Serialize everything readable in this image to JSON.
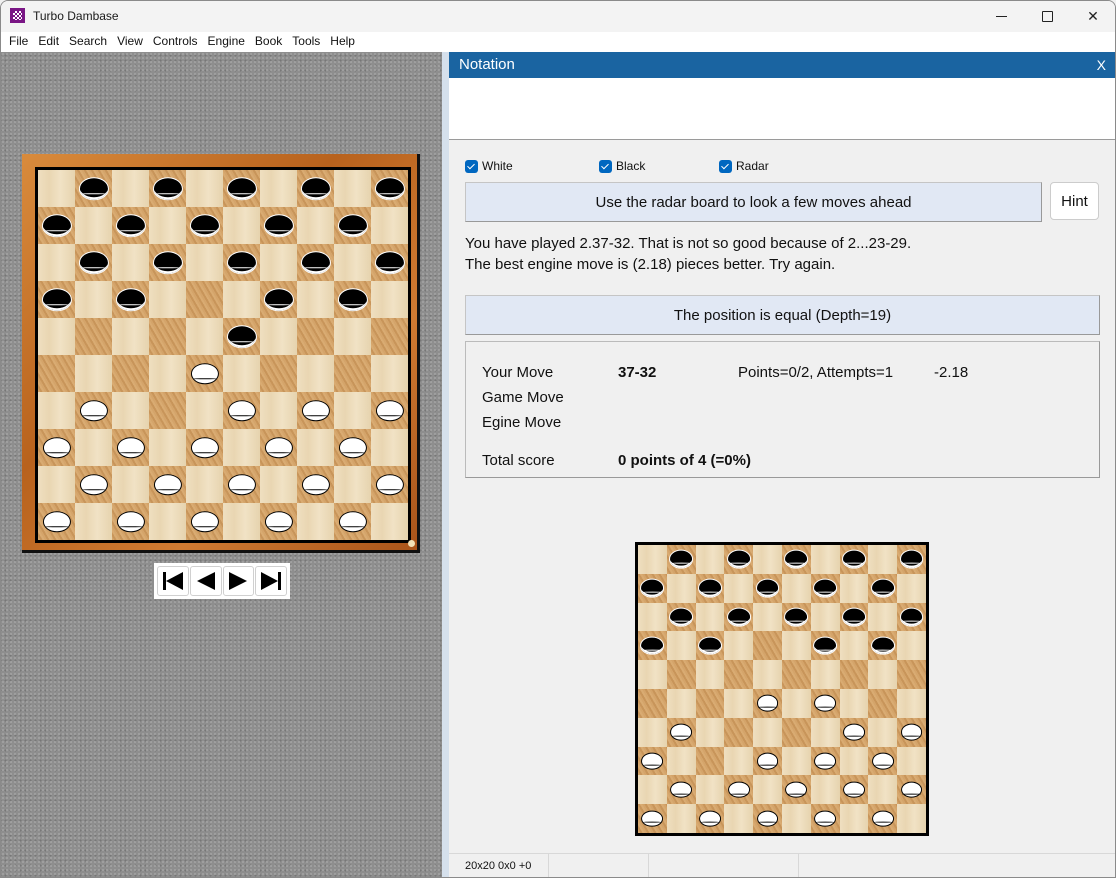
{
  "window": {
    "title": "Turbo Dambase",
    "controls": [
      "minimize",
      "maximize",
      "close"
    ]
  },
  "menu": [
    "File",
    "Edit",
    "Search",
    "View",
    "Controls",
    "Engine",
    "Book",
    "Tools",
    "Help"
  ],
  "main_board": {
    "size": 10,
    "pieces": [
      {
        "row": 0,
        "col": 1,
        "color": "black"
      },
      {
        "row": 0,
        "col": 3,
        "color": "black"
      },
      {
        "row": 0,
        "col": 5,
        "color": "black"
      },
      {
        "row": 0,
        "col": 7,
        "color": "black"
      },
      {
        "row": 0,
        "col": 9,
        "color": "black"
      },
      {
        "row": 1,
        "col": 0,
        "color": "black"
      },
      {
        "row": 1,
        "col": 2,
        "color": "black"
      },
      {
        "row": 1,
        "col": 4,
        "color": "black"
      },
      {
        "row": 1,
        "col": 6,
        "color": "black"
      },
      {
        "row": 1,
        "col": 8,
        "color": "black"
      },
      {
        "row": 2,
        "col": 1,
        "color": "black"
      },
      {
        "row": 2,
        "col": 3,
        "color": "black"
      },
      {
        "row": 2,
        "col": 5,
        "color": "black"
      },
      {
        "row": 2,
        "col": 7,
        "color": "black"
      },
      {
        "row": 2,
        "col": 9,
        "color": "black"
      },
      {
        "row": 3,
        "col": 0,
        "color": "black"
      },
      {
        "row": 3,
        "col": 2,
        "color": "black"
      },
      {
        "row": 3,
        "col": 6,
        "color": "black"
      },
      {
        "row": 3,
        "col": 8,
        "color": "black"
      },
      {
        "row": 4,
        "col": 5,
        "color": "black"
      },
      {
        "row": 5,
        "col": 4,
        "color": "white"
      },
      {
        "row": 6,
        "col": 1,
        "color": "white"
      },
      {
        "row": 6,
        "col": 5,
        "color": "white"
      },
      {
        "row": 6,
        "col": 7,
        "color": "white"
      },
      {
        "row": 6,
        "col": 9,
        "color": "white"
      },
      {
        "row": 7,
        "col": 0,
        "color": "white"
      },
      {
        "row": 7,
        "col": 2,
        "color": "white"
      },
      {
        "row": 7,
        "col": 4,
        "color": "white"
      },
      {
        "row": 7,
        "col": 6,
        "color": "white"
      },
      {
        "row": 7,
        "col": 8,
        "color": "white"
      },
      {
        "row": 8,
        "col": 1,
        "color": "white"
      },
      {
        "row": 8,
        "col": 3,
        "color": "white"
      },
      {
        "row": 8,
        "col": 5,
        "color": "white"
      },
      {
        "row": 8,
        "col": 7,
        "color": "white"
      },
      {
        "row": 8,
        "col": 9,
        "color": "white"
      },
      {
        "row": 9,
        "col": 0,
        "color": "white"
      },
      {
        "row": 9,
        "col": 2,
        "color": "white"
      },
      {
        "row": 9,
        "col": 4,
        "color": "white"
      },
      {
        "row": 9,
        "col": 6,
        "color": "white"
      },
      {
        "row": 9,
        "col": 8,
        "color": "white"
      }
    ]
  },
  "navigation": {
    "buttons": [
      {
        "name": "first-move",
        "icon": "skip-back-icon"
      },
      {
        "name": "previous-move",
        "icon": "play-back-icon"
      },
      {
        "name": "next-move",
        "icon": "play-forward-icon"
      },
      {
        "name": "last-move",
        "icon": "skip-forward-icon"
      }
    ]
  },
  "notation": {
    "title": "Notation",
    "close_label": "X"
  },
  "checkboxes": [
    {
      "label": "White",
      "checked": true
    },
    {
      "label": "Black",
      "checked": true
    },
    {
      "label": "Radar",
      "checked": true
    }
  ],
  "radar_button_label": "Use the radar board to look a few moves ahead",
  "hint_label": "Hint",
  "message": {
    "line1": "You have played 2.37-32. That is not so good because of 2...23-29.",
    "line2": "The best engine move is (2.18) pieces better. Try again."
  },
  "evaluation": "The position is equal (Depth=19)",
  "score": {
    "your_move_label": "Your Move",
    "your_move_value": "37-32",
    "your_move_points": "Points=0/2, Attempts=1",
    "your_move_eval": "-2.18",
    "game_move_label": "Game Move",
    "engine_move_label": "Egine Move",
    "total_label": "Total score",
    "total_value": "0 points of 4 (=0%)"
  },
  "radar_board": {
    "size": 10,
    "pieces": [
      {
        "row": 0,
        "col": 1,
        "color": "black"
      },
      {
        "row": 0,
        "col": 3,
        "color": "black"
      },
      {
        "row": 0,
        "col": 5,
        "color": "black"
      },
      {
        "row": 0,
        "col": 7,
        "color": "black"
      },
      {
        "row": 0,
        "col": 9,
        "color": "black"
      },
      {
        "row": 1,
        "col": 0,
        "color": "black"
      },
      {
        "row": 1,
        "col": 2,
        "color": "black"
      },
      {
        "row": 1,
        "col": 4,
        "color": "black"
      },
      {
        "row": 1,
        "col": 6,
        "color": "black"
      },
      {
        "row": 1,
        "col": 8,
        "color": "black"
      },
      {
        "row": 2,
        "col": 1,
        "color": "black"
      },
      {
        "row": 2,
        "col": 3,
        "color": "black"
      },
      {
        "row": 2,
        "col": 5,
        "color": "black"
      },
      {
        "row": 2,
        "col": 7,
        "color": "black"
      },
      {
        "row": 2,
        "col": 9,
        "color": "black"
      },
      {
        "row": 3,
        "col": 0,
        "color": "black"
      },
      {
        "row": 3,
        "col": 2,
        "color": "black"
      },
      {
        "row": 3,
        "col": 6,
        "color": "black"
      },
      {
        "row": 3,
        "col": 8,
        "color": "black"
      },
      {
        "row": 5,
        "col": 4,
        "color": "white"
      },
      {
        "row": 5,
        "col": 6,
        "color": "white"
      },
      {
        "row": 6,
        "col": 1,
        "color": "white"
      },
      {
        "row": 6,
        "col": 7,
        "color": "white"
      },
      {
        "row": 6,
        "col": 9,
        "color": "white"
      },
      {
        "row": 7,
        "col": 0,
        "color": "white"
      },
      {
        "row": 7,
        "col": 4,
        "color": "white"
      },
      {
        "row": 7,
        "col": 6,
        "color": "white"
      },
      {
        "row": 7,
        "col": 8,
        "color": "white"
      },
      {
        "row": 8,
        "col": 1,
        "color": "white"
      },
      {
        "row": 8,
        "col": 3,
        "color": "white"
      },
      {
        "row": 8,
        "col": 5,
        "color": "white"
      },
      {
        "row": 8,
        "col": 7,
        "color": "white"
      },
      {
        "row": 8,
        "col": 9,
        "color": "white"
      },
      {
        "row": 9,
        "col": 0,
        "color": "white"
      },
      {
        "row": 9,
        "col": 2,
        "color": "white"
      },
      {
        "row": 9,
        "col": 4,
        "color": "white"
      },
      {
        "row": 9,
        "col": 6,
        "color": "white"
      },
      {
        "row": 9,
        "col": 8,
        "color": "white"
      }
    ]
  },
  "statusbar": [
    "20x20 0x0 +0",
    "",
    "",
    ""
  ]
}
